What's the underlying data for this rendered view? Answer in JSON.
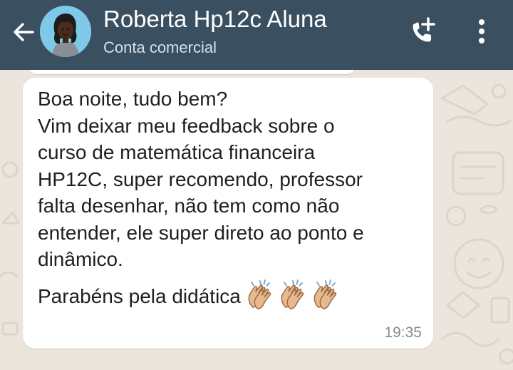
{
  "header": {
    "contact_name": "Roberta Hp12c Aluna",
    "contact_subtitle": "Conta comercial",
    "icons": {
      "back": "arrow-left-icon",
      "avatar": "person-avatar",
      "call": "add-call-icon",
      "menu": "more-vert-icon"
    }
  },
  "message": {
    "lines": [
      "Boa noite, tudo bem?",
      "Vim deixar meu feedback sobre o",
      "curso de matemática financeira",
      "HP12C, super recomendo, professor",
      "falta desenhar, não tem como não",
      "entender, ele super direto ao ponto e",
      "dinâmico."
    ],
    "closing_line": "Parabéns pela didática",
    "emoji": [
      "clapping-hands-icon",
      "clapping-hands-icon",
      "clapping-hands-icon"
    ],
    "time": "19:35"
  },
  "colors": {
    "app_bar": "#3A5061",
    "chat_background": "#ECE5DD",
    "bubble": "#FFFFFF",
    "message_text": "#1F1F1F",
    "time_text": "#8A8A8A"
  }
}
